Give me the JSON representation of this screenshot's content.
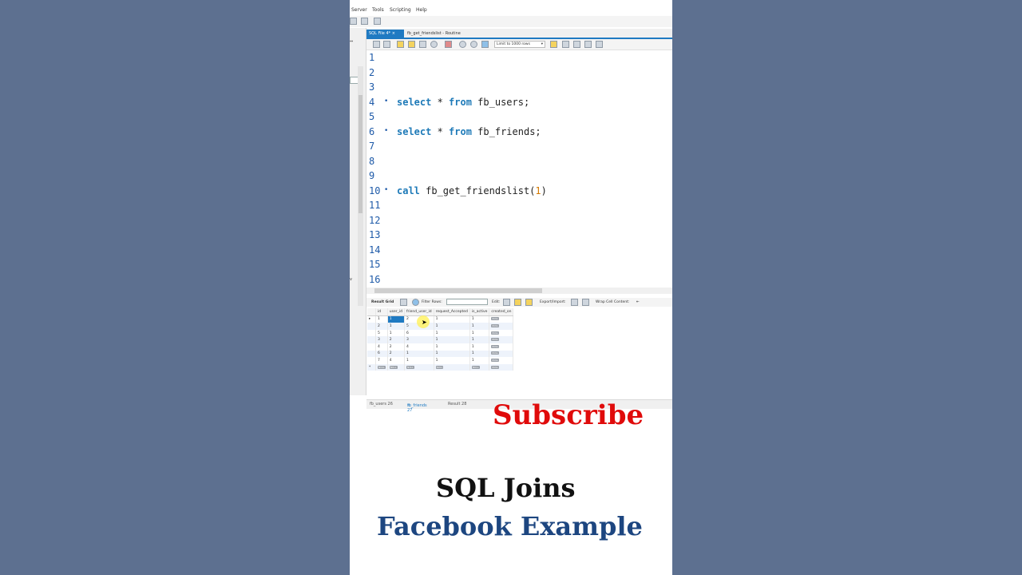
{
  "menu": [
    "Server",
    "Tools",
    "Scripting",
    "Help"
  ],
  "tabs": [
    {
      "label": "SQL File 4*",
      "close": "×",
      "active": true
    },
    {
      "label": "fb_get_friendslist - Routine",
      "active": false
    }
  ],
  "editor_toolbar": {
    "limit_label": "Limit to 1000 rows",
    "limit_arrow": "▾"
  },
  "editor": {
    "line_numbers": [
      "1",
      "2",
      "3",
      "4",
      "5",
      "6",
      "7",
      "8",
      "9",
      "10",
      "11",
      "12",
      "13",
      "14",
      "15",
      "16"
    ],
    "statements": [
      {
        "line": "4",
        "kw1": "select",
        "mid": " * ",
        "kw2": "from",
        "rest": " fb_users;"
      },
      {
        "line": "6",
        "kw1": "select",
        "mid": " * ",
        "kw2": "from",
        "rest": " fb_friends;"
      }
    ],
    "call": {
      "line": "10",
      "kw": "call",
      "name": " fb_get_friendslist(",
      "arg": "1",
      "close": ")"
    },
    "bullet": "•"
  },
  "results_toolbar": {
    "result_grid": "Result Grid",
    "filter_rows": "Filter Rows:",
    "edit": "Edit:",
    "export_import": "Export/Import:",
    "wrap_cell": "Wrap Cell Content:"
  },
  "grid": {
    "columns": [
      "id",
      "user_id",
      "friend_user_id",
      "request_Accepted",
      "is_active",
      "created_on"
    ],
    "rows": [
      [
        "1",
        "1",
        "2",
        "1",
        "1",
        "NULL"
      ],
      [
        "2",
        "1",
        "5",
        "1",
        "1",
        "NULL"
      ],
      [
        "5",
        "1",
        "6",
        "1",
        "1",
        "NULL"
      ],
      [
        "3",
        "2",
        "3",
        "1",
        "1",
        "NULL"
      ],
      [
        "4",
        "2",
        "4",
        "1",
        "1",
        "NULL"
      ],
      [
        "6",
        "2",
        "1",
        "1",
        "1",
        "NULL"
      ],
      [
        "7",
        "4",
        "1",
        "1",
        "1",
        "NULL"
      ],
      [
        "NULL",
        "NULL",
        "NULL",
        "NULL",
        "NULL",
        "NULL"
      ]
    ],
    "row_marker": "▸",
    "new_row_marker": "*"
  },
  "bottom_tabs": [
    {
      "label": "fb_users 26",
      "active": false
    },
    {
      "label": "fb_friends 27",
      "active": true,
      "close": "×"
    },
    {
      "label": "Result 28",
      "active": false
    }
  ],
  "overlay": {
    "subscribe": "Subscribe",
    "title_line1": "SQL Joins",
    "title_line2": "Facebook Example"
  },
  "colors": {
    "accent": "#1f7ac2",
    "subscribe": "#e00b0b",
    "title2": "#1d4680",
    "background": "#5d7090"
  }
}
